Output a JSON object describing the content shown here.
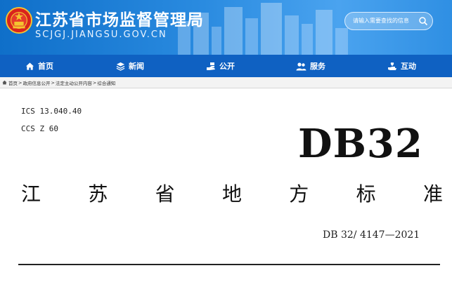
{
  "header": {
    "title": "江苏省市场监督管理局",
    "url": "SCJGJ.JIANGSU.GOV.CN",
    "search_placeholder": "请输入需要查找的信息",
    "brand_color": "#1a7bd6"
  },
  "nav": {
    "items": [
      {
        "label": "首页",
        "icon": "home-icon"
      },
      {
        "label": "新闻",
        "icon": "layers-icon"
      },
      {
        "label": "公开",
        "icon": "hand-icon"
      },
      {
        "label": "服务",
        "icon": "users-icon"
      },
      {
        "label": "互动",
        "icon": "heart-hand-icon"
      }
    ],
    "color": "#0f61c2"
  },
  "breadcrumb": [
    "首页",
    "政府信息公开",
    "法定主动公开内容",
    "综合通知"
  ],
  "document": {
    "ics": "ICS 13.040.40",
    "ccs": "CCS Z 60",
    "code": "DB32",
    "title_chars": [
      "江",
      "苏",
      "省",
      "地",
      "方",
      "标",
      "准"
    ],
    "number": "DB 32/ 4147—2021"
  }
}
